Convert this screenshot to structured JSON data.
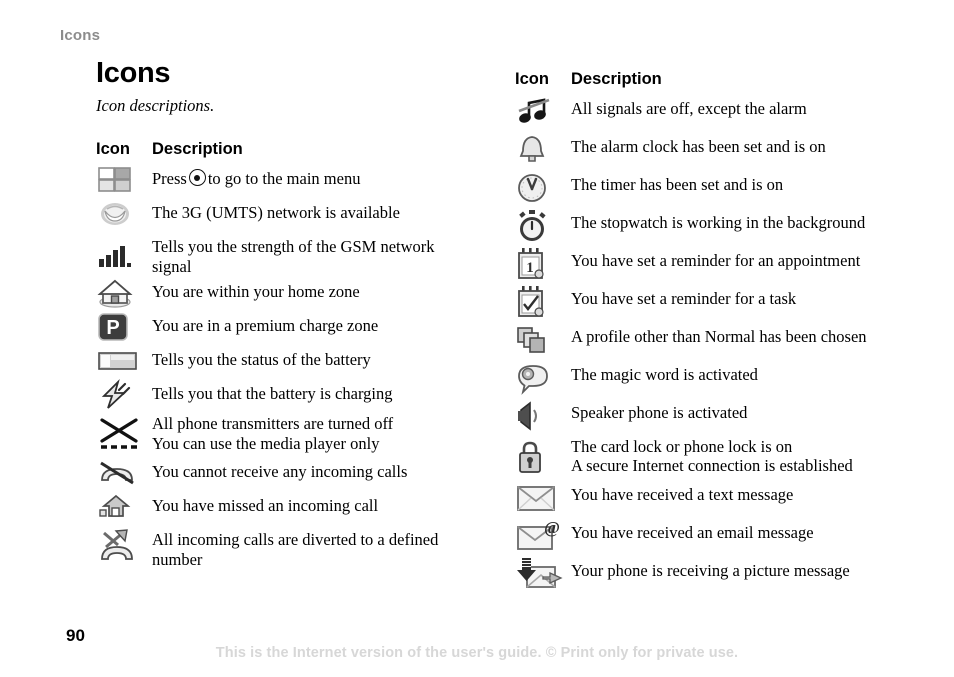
{
  "running_head": "Icons",
  "chapter": {
    "title": "Icons",
    "subtitle": "Icon descriptions."
  },
  "page_number": "90",
  "footer_note": "This is the Internet version of the user's guide. © Print only for private use.",
  "colors": {
    "text": "#000000",
    "running_head": "#8c8c8c",
    "footer_note": "#d7d7d7",
    "icon_dark": "#3a3a3a",
    "icon_mid": "#9a9a9a",
    "icon_light": "#d2d2d2",
    "page_background": "#ffffff"
  },
  "left_table": {
    "header": {
      "icon": "Icon",
      "description": "Description"
    },
    "rows": [
      {
        "icon_name": "main-menu-grid-icon",
        "description_pre": "Press",
        "description_post": "to go to the main menu",
        "line2": ""
      },
      {
        "icon_name": "3g-umts-network-icon",
        "description": "The 3G (UMTS) network is available",
        "line2": ""
      },
      {
        "icon_name": "gsm-signal-strength-icon",
        "description": "Tells you the strength of the GSM network",
        "line2": "signal"
      },
      {
        "icon_name": "home-zone-icon",
        "description": "You are within your home zone",
        "line2": ""
      },
      {
        "icon_name": "premium-charge-zone-icon",
        "description": "You are in a premium charge zone",
        "line2": ""
      },
      {
        "icon_name": "battery-status-icon",
        "description": "Tells you the status of the battery",
        "line2": ""
      },
      {
        "icon_name": "battery-charging-icon",
        "description": "Tells you that the battery is charging",
        "line2": ""
      },
      {
        "icon_name": "flight-mode-icon",
        "description": "All phone transmitters are turned off",
        "line2": "You can use the media player only"
      },
      {
        "icon_name": "no-incoming-calls-icon",
        "description": "You cannot receive any incoming calls",
        "line2": ""
      },
      {
        "icon_name": "missed-call-icon",
        "description": "You have missed an incoming call",
        "line2": ""
      },
      {
        "icon_name": "call-divert-icon",
        "description": "All incoming calls are diverted to a defined",
        "line2": "number"
      }
    ]
  },
  "right_table": {
    "header": {
      "icon": "Icon",
      "description": "Description"
    },
    "rows": [
      {
        "icon_name": "silent-mode-music-note-icon",
        "description": "All signals are off, except the alarm",
        "line2": ""
      },
      {
        "icon_name": "alarm-clock-bell-icon",
        "description": "The alarm clock has been set and is on",
        "line2": ""
      },
      {
        "icon_name": "timer-icon",
        "description": "The timer has been set and is on",
        "line2": ""
      },
      {
        "icon_name": "stopwatch-icon",
        "description": "The stopwatch is working in the background",
        "line2": ""
      },
      {
        "icon_name": "appointment-reminder-icon",
        "description": "You have set a reminder for an appointment",
        "line2": ""
      },
      {
        "icon_name": "task-reminder-icon",
        "description": "You have set a reminder for a task",
        "line2": ""
      },
      {
        "icon_name": "profile-icon",
        "description": "A profile other than Normal has been chosen",
        "line2": ""
      },
      {
        "icon_name": "magic-word-icon",
        "description": "The magic word is activated",
        "line2": ""
      },
      {
        "icon_name": "speaker-phone-icon",
        "description": "Speaker phone is activated",
        "line2": ""
      },
      {
        "icon_name": "lock-icon",
        "description": "The card lock or phone lock is on",
        "line2": "A secure Internet connection is established"
      },
      {
        "icon_name": "text-message-envelope-icon",
        "description": "You have received a text message",
        "line2": ""
      },
      {
        "icon_name": "email-message-envelope-icon",
        "description": "You have received an email message",
        "line2": ""
      },
      {
        "icon_name": "picture-message-incoming-icon",
        "description": "Your phone is receiving a picture message",
        "line2": ""
      }
    ]
  }
}
